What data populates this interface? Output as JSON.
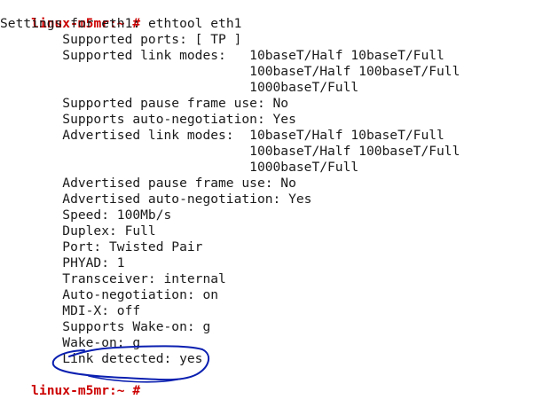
{
  "terminal": {
    "prompt1": {
      "user": "linux-m5mr:~ #",
      "command": " ethtool eth1"
    },
    "lines": [
      "Settings for eth1:",
      "        Supported ports: [ TP ]",
      "        Supported link modes:   10baseT/Half 10baseT/Full",
      "                                100baseT/Half 100baseT/Full",
      "                                1000baseT/Full",
      "        Supported pause frame use: No",
      "        Supports auto-negotiation: Yes",
      "        Advertised link modes:  10baseT/Half 10baseT/Full",
      "                                100baseT/Half 100baseT/Full",
      "                                1000baseT/Full",
      "        Advertised pause frame use: No",
      "        Advertised auto-negotiation: Yes",
      "        Speed: 100Mb/s",
      "        Duplex: Full",
      "        Port: Twisted Pair",
      "        PHYAD: 1",
      "        Transceiver: internal",
      "        Auto-negotiation: on",
      "        MDI-X: off",
      "        Supports Wake-on: g",
      "        Wake-on: g",
      "        Link detected: yes"
    ],
    "prompt2": {
      "user": "linux-m5mr:~ #",
      "command": ""
    },
    "annotation_color": "#0a1fb0",
    "prompt_color": "#cc0000"
  }
}
